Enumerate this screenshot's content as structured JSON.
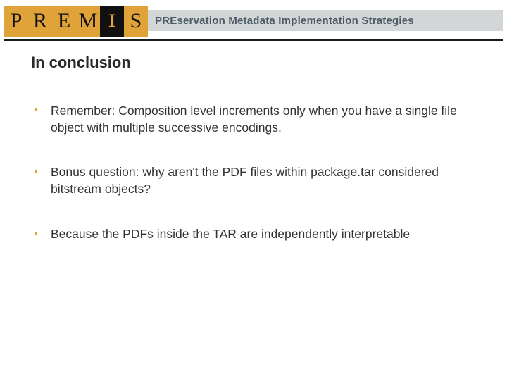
{
  "logo": {
    "letters": [
      "P",
      "R",
      "E",
      "M",
      "I",
      "S"
    ],
    "title_prefix": "PRE",
    "title_rest": "servation Metadata Implementation Strategies"
  },
  "heading": "In conclusion",
  "bullets": [
    "Remember: Composition level increments only when you have a single file object with multiple successive encodings.",
    "Bonus question: why aren't the PDF files within package.tar considered bitstream objects?",
    "Because the PDFs inside the TAR are independently interpretable"
  ]
}
